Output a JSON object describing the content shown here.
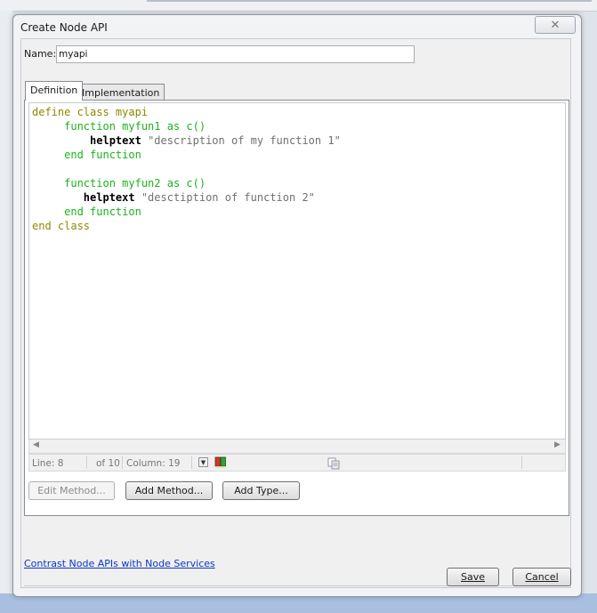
{
  "dialog": {
    "title": "Create Node API",
    "close_glyph": "✕"
  },
  "name_field": {
    "label": "Name:",
    "value": "myapi"
  },
  "tabs": [
    {
      "label": "Definition",
      "selected": true
    },
    {
      "label": "Implementation",
      "selected": false
    }
  ],
  "code_lines": [
    {
      "indent": "",
      "parts": [
        {
          "t": "define class myapi",
          "c": "olive"
        }
      ]
    },
    {
      "indent": "     ",
      "parts": [
        {
          "t": "function myfun1 as c()",
          "c": "green"
        }
      ]
    },
    {
      "indent": "         ",
      "parts": [
        {
          "t": "helptext ",
          "c": "black"
        },
        {
          "t": "\"description of my function 1\"",
          "c": "str"
        }
      ]
    },
    {
      "indent": "     ",
      "parts": [
        {
          "t": "end function",
          "c": "green"
        }
      ]
    },
    {
      "indent": "",
      "parts": []
    },
    {
      "indent": "     ",
      "parts": [
        {
          "t": "function myfun2 as c()",
          "c": "green"
        }
      ]
    },
    {
      "indent": "        ",
      "parts": [
        {
          "t": "helptext ",
          "c": "black"
        },
        {
          "t": "\"desctiption of function 2\"",
          "c": "str"
        }
      ]
    },
    {
      "indent": "     ",
      "parts": [
        {
          "t": "end function",
          "c": "green"
        }
      ]
    },
    {
      "indent": "",
      "parts": [
        {
          "t": "end class",
          "c": "olive"
        }
      ]
    }
  ],
  "status": {
    "line": "Line: 8",
    "of_lines": "of 10",
    "column": "Column: 19"
  },
  "buttons": {
    "edit_method": "Edit Method...",
    "add_method": "Add Method...",
    "add_type": "Add Type...",
    "save": "Save",
    "cancel": "Cancel"
  },
  "link_text": "Contrast Node APIs with Node Services",
  "colors": {
    "olive": "#8a8a00",
    "green": "#1bb31b",
    "string": "#707070",
    "link": "#0a36c9"
  }
}
